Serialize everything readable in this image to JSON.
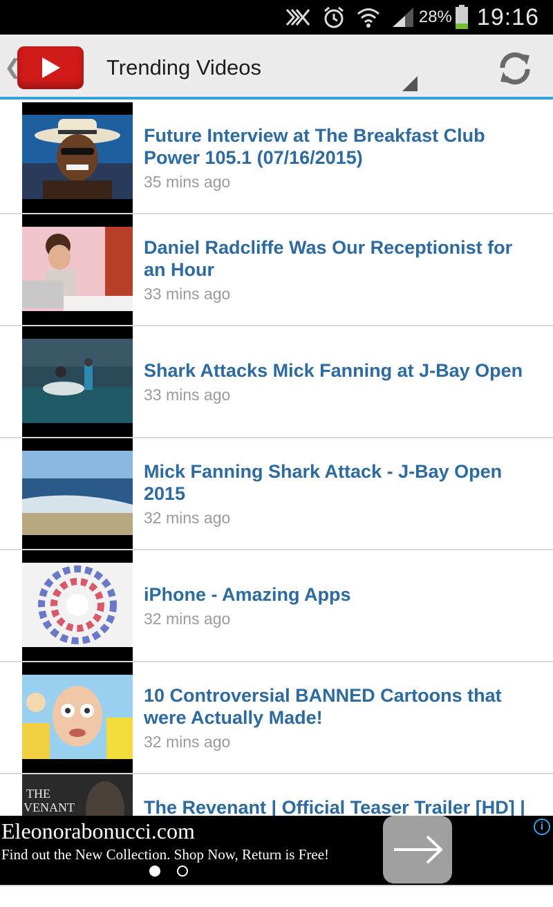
{
  "status_bar": {
    "battery": "28%",
    "time": "19:16",
    "icons": [
      "nfc-icon",
      "alarm-icon",
      "wifi-icon",
      "signal-icon",
      "battery-icon"
    ]
  },
  "action_bar": {
    "title": "Trending Videos",
    "logo_icon": "youtube-logo-icon",
    "refresh_icon": "refresh-icon",
    "colors": {
      "accent": "#33a3dc",
      "logo_red": "#d11a1a",
      "title_link": "#2c6aa0"
    }
  },
  "videos": [
    {
      "title": "Future Interview at The Breakfast Club Power 105.1 (07/16/2015)",
      "time": "35 mins ago"
    },
    {
      "title": "Daniel Radcliffe Was Our Receptionist for an Hour",
      "time": "33 mins ago"
    },
    {
      "title": "Shark Attacks Mick Fanning at J-Bay Open",
      "time": "33 mins ago"
    },
    {
      "title": "Mick Fanning Shark Attack - J-Bay Open 2015",
      "time": "32 mins ago"
    },
    {
      "title": "iPhone - Amazing Apps",
      "time": "32 mins ago"
    },
    {
      "title": "10 Controversial BANNED Cartoons that were Actually Made!",
      "time": "32 mins ago"
    },
    {
      "title": "The Revenant | Official Teaser Trailer [HD] |",
      "time": ""
    }
  ],
  "ad": {
    "domain": "Eleonorabonucci.com",
    "text": "Find out the New Collection. Shop Now, Return is Free!",
    "info_icon": "i",
    "active_page": 1,
    "page_count": 2
  }
}
